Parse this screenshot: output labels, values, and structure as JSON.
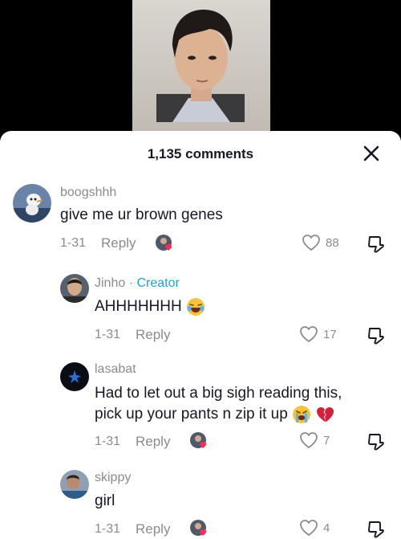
{
  "header": {
    "comment_count": "1,135 comments"
  },
  "comments": [
    {
      "username": "boogshhh",
      "text": "give me ur brown genes",
      "date": "1-31",
      "reply_label": "Reply",
      "likes": "88"
    },
    {
      "username": "Jinho",
      "separator": "·",
      "badge": "Creator",
      "text": "AHHHHHHH",
      "date": "1-31",
      "reply_label": "Reply",
      "likes": "17"
    },
    {
      "username": "lasabat",
      "text_line1": "Had to let out a big sigh reading this,",
      "text_line2": "pick up your pants n zip it up",
      "date": "1-31",
      "reply_label": "Reply",
      "likes": "7"
    },
    {
      "username": "skippy",
      "text": "girl",
      "date": "1-31",
      "reply_label": "Reply",
      "likes": "4"
    }
  ],
  "colors": {
    "creator": "#20a0d8",
    "heart_badge": "#fe2c55",
    "muted": "#8a8b91",
    "text": "#161823"
  },
  "icons": [
    "close-icon",
    "heart-outline-icon",
    "dislike-icon",
    "creator-liked-avatar-icon",
    "laughing-emoji-icon",
    "crying-emoji-icon",
    "broken-heart-emoji-icon"
  ]
}
